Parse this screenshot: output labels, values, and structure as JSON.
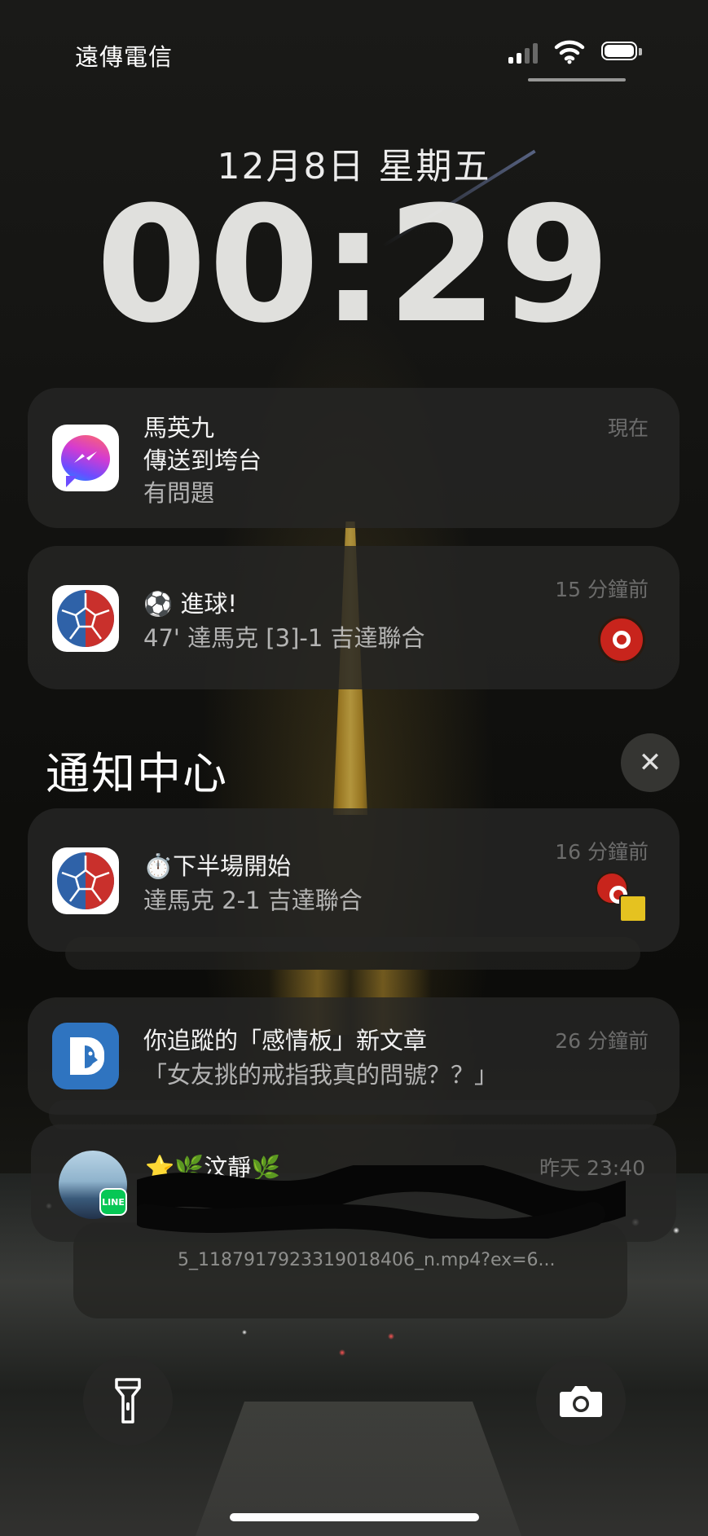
{
  "status_bar": {
    "carrier": "遠傳電信",
    "icons": [
      "cellular-signal-icon",
      "wifi-icon",
      "battery-icon"
    ]
  },
  "lock_screen": {
    "date": "12月8日 星期五",
    "time": "00:29"
  },
  "notifications": [
    {
      "app": "messenger",
      "icon": "messenger-icon",
      "title": "馬英九",
      "subtitle": "傳送到垮台",
      "body": "有問題",
      "time": "現在"
    },
    {
      "app": "sports",
      "icon": "soccer-app-icon",
      "title": "⚽️ 進球!",
      "body": "47' 達馬克 [3]-1 吉達聯合",
      "time": "15 分鐘前"
    }
  ],
  "notification_center": {
    "title": "通知中心",
    "clear_label": "✕"
  },
  "center_notifications": [
    {
      "app": "sports",
      "icon": "soccer-app-icon",
      "title": "⏱️下半場開始",
      "body": "達馬克 2-1 吉達聯合",
      "time": "16 分鐘前"
    },
    {
      "app": "dcard",
      "icon": "dcard-icon",
      "title": "你追蹤的「感情板」新文章",
      "body": "「女友挑的戒指我真的問號？？」",
      "time": "26 分鐘前"
    },
    {
      "app": "line",
      "icon": "contact-avatar",
      "title": "⭐️🌿汶靜🌿",
      "body": "",
      "time": "昨天 23:40",
      "attachment": "5_1187917923319018406_n.mp4?ex=6..."
    }
  ],
  "quick_actions": {
    "flashlight": "flashlight-icon",
    "camera": "camera-icon"
  },
  "colors": {
    "card_bg": "#262624",
    "messenger_gradient": [
      "#ff6a68",
      "#d53bd0",
      "#6c4cff",
      "#1c8bff"
    ],
    "sports_blue": "#2f62a8",
    "sports_red": "#c9302c",
    "dcard_blue": "#2f74c0",
    "line_green": "#06c755"
  }
}
